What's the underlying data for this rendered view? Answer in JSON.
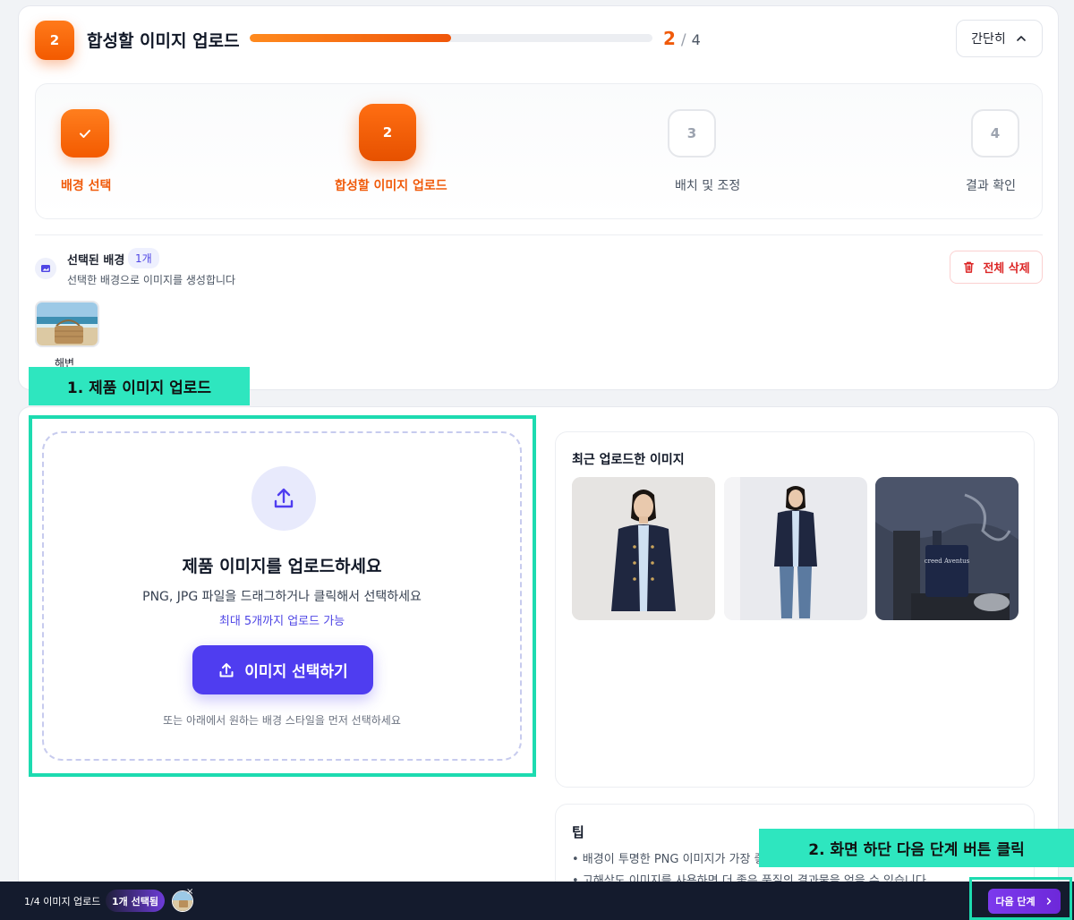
{
  "header": {
    "step_number": "2",
    "title": "합성할 이미지 업로드",
    "progress": 0.5,
    "current": "2",
    "separator": "/",
    "total": "4",
    "collapse_label": "간단히"
  },
  "steps": [
    {
      "num": "",
      "label": "배경 선택",
      "state": "done"
    },
    {
      "num": "2",
      "label": "합성할 이미지 업로드",
      "state": "active"
    },
    {
      "num": "3",
      "label": "배치 및 조정",
      "state": "todo"
    },
    {
      "num": "4",
      "label": "결과 확인",
      "state": "todo"
    }
  ],
  "selected_bg": {
    "title": "선택된 배경",
    "count": "1개",
    "subtitle": "선택한 배경으로 이미지를 생성합니다",
    "delete_label": "전체 삭제",
    "thumb_label": "해변"
  },
  "callouts": {
    "one": "1. 제품 이미지 업로드",
    "two": "2. 화면 하단 다음 단계 버튼 클릭"
  },
  "upload": {
    "title": "제품 이미지를 업로드하세요",
    "subtitle": "PNG, JPG 파일을 드래그하거나 클릭해서 선택하세요",
    "max_note": "최대 5개까지 업로드 가능",
    "button_label": "이미지 선택하기",
    "hint": "또는 아래에서 원하는 배경 스타일을 먼저 선택하세요"
  },
  "recent": {
    "title": "최근 업로드한 이미지",
    "bottle_text": "creed Aventus"
  },
  "tips": {
    "title": "팁",
    "items": [
      "• 배경이 투명한 PNG 이미지가 가장 좋",
      "• 고해상도 이미지를 사용하면 더 좋은 품질의 결과물을 얻을 수 있습니다"
    ]
  },
  "bottombar": {
    "step_label": "1/4 이미지 업로드",
    "selected_pill": "1개 선택됨",
    "remove_x": "×",
    "next_label": "다음 단계"
  },
  "colors": {
    "accent_orange": "#f05a0a",
    "accent_purple": "#4f3df0",
    "callout_teal": "#2ee6bf",
    "bottombar": "#141b2d"
  }
}
